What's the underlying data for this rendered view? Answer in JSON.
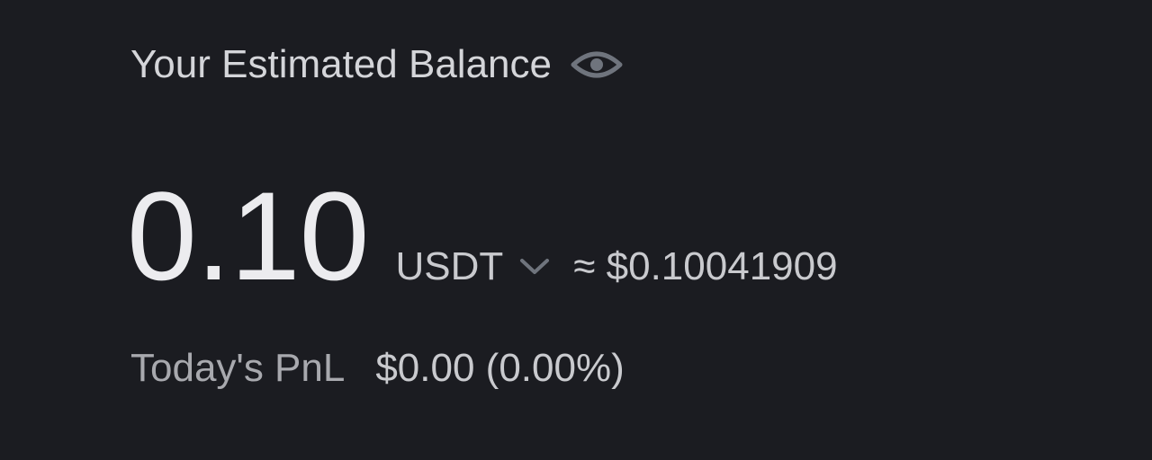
{
  "balance": {
    "title": "Your Estimated Balance",
    "amount": "0.10",
    "unit": "USDT",
    "approx_value": "≈ $0.10041909",
    "pnl_label": "Today's PnL",
    "pnl_value": "$0.00 (0.00%)"
  },
  "icons": {
    "visibility": "eye-icon",
    "unit_dropdown": "chevron-down-icon"
  },
  "colors": {
    "background": "#1b1c21",
    "primary_text": "#ececef",
    "secondary_text": "#c9cace",
    "muted_text": "#a8a9ae",
    "icon": "#6f747d"
  }
}
